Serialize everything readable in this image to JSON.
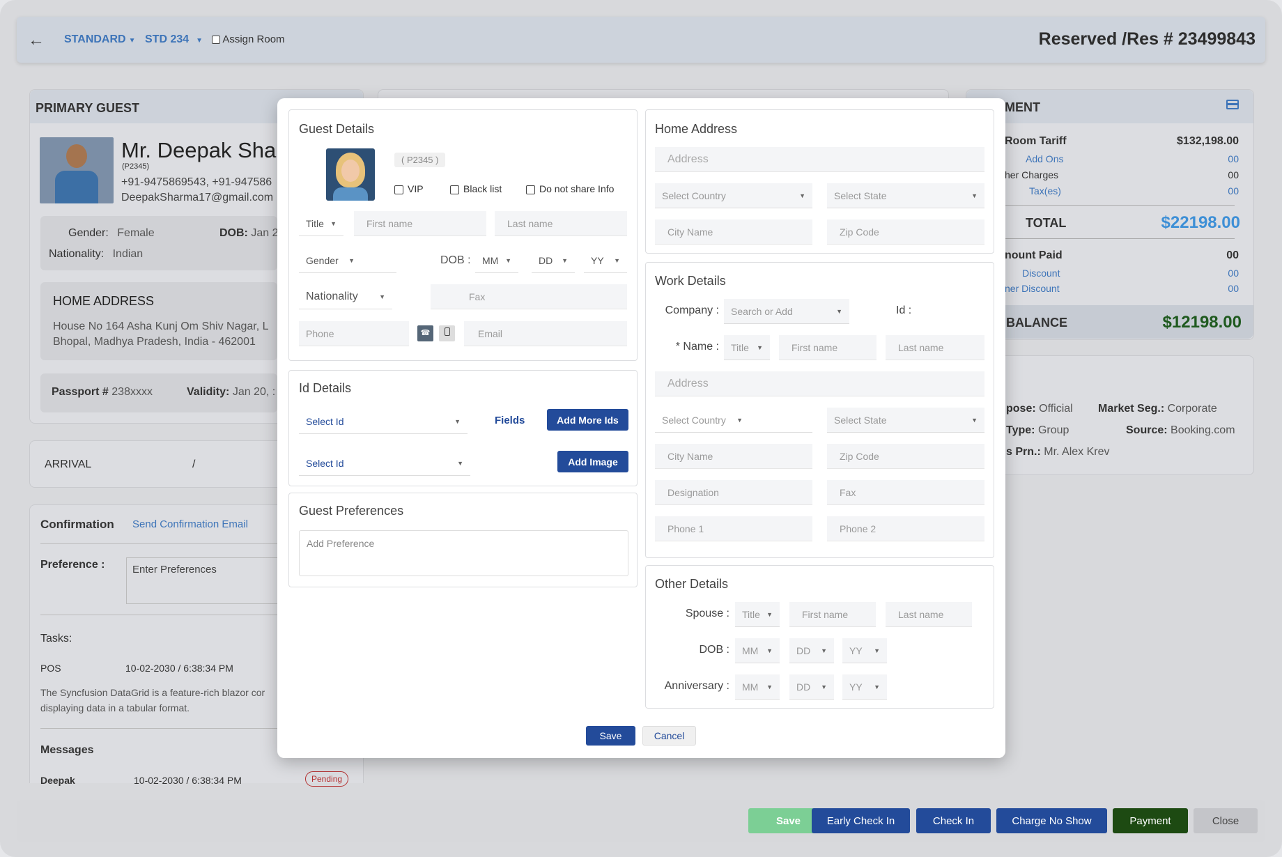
{
  "topbar": {
    "room_type": "STANDARD",
    "room_no": "STD 234",
    "assign_room": "Assign Room",
    "title": "Reserved /Res # 23499843"
  },
  "guest": {
    "section": "PRIMARY GUEST",
    "name": "Mr. Deepak Shar",
    "code": "(P2345)",
    "phones": "+91-9475869543, +91-947586",
    "email": "DeepakSharma17@gmail.com",
    "gender_label": "Gender:",
    "gender": "Female",
    "dob_label": "DOB:",
    "dob": "Jan 2",
    "nationality_label": "Nationality:",
    "nationality": "Indian",
    "home_address_title": "HOME ADDRESS",
    "address_line1": "House No 164 Asha Kunj Om Shiv Nagar, L",
    "address_line2": "Bhopal, Madhya Pradesh, India - 462001",
    "passport_label": "Passport #",
    "passport": "238xxxx",
    "validity_label": "Validity:",
    "validity": "Jan 20, :"
  },
  "arrival": {
    "label": "ARRIVAL",
    "sep": "/"
  },
  "confirmation": {
    "title": "Confirmation",
    "send_link": "Send Confirmation Email",
    "pref_label": "Preference :",
    "pref_placeholder": "Enter Preferences",
    "tasks_label": "Tasks:",
    "task_name": "POS",
    "task_time": "10-02-2030 / 6:38:34 PM",
    "task_desc1": "The Syncfusion DataGrid is a feature-rich blazor cor",
    "task_desc2": "displaying data in a tabular format.",
    "messages_label": "Messages",
    "msg_name": "Deepak",
    "msg_time": "10-02-2030 / 6:38:34 PM",
    "msg_status": "Pending"
  },
  "payment": {
    "title": "MENT",
    "room_tariff_label": "Room Tariff",
    "room_tariff": "$132,198.00",
    "addons_label": "Add Ons",
    "addons": "00",
    "other_charges_label": "her Charges",
    "other_charges": "00",
    "taxes_label": "Tax(es)",
    "taxes": "00",
    "total_label": "TOTAL",
    "total": "$22198.00",
    "amount_paid_label": "nount Paid",
    "amount_paid": "00",
    "discount_label": "Discount",
    "discount": "00",
    "other_discount_label": "ner Discount",
    "other_discount": "00",
    "balance_label": "BALANCE",
    "balance": "$12198.00"
  },
  "info": {
    "purpose_label": "pose:",
    "purpose": "Official",
    "market_label": "Market Seg.:",
    "market": "Corporate",
    "type_label": "Type:",
    "type": "Group",
    "source_label": "Source:",
    "source": "Booking.com",
    "prn_label": "s Prn.:",
    "prn": "Mr. Alex Krev"
  },
  "modal": {
    "guest_details": {
      "title": "Guest Details",
      "code": "( P2345 )",
      "vip": "VIP",
      "blacklist": "Black list",
      "no_share": "Do not share Info",
      "title_sel": "Title",
      "first_name": "First name",
      "last_name": "Last name",
      "gender_sel": "Gender",
      "dob_label": "DOB :",
      "mm": "MM",
      "dd": "DD",
      "yy": "YY",
      "nationality_sel": "Nationality",
      "fax": "Fax",
      "phone": "Phone",
      "email": "Email"
    },
    "id_details": {
      "title": "Id Details",
      "select_id1": "Select Id",
      "fields": "Fields",
      "add_more": "Add More Ids",
      "select_id2": "Select Id",
      "add_image": "Add Image"
    },
    "preferences": {
      "title": "Guest Preferences",
      "placeholder": "Add Preference"
    },
    "home_address": {
      "title": "Home Address",
      "address": "Address",
      "country": "Select Country",
      "state": "Select State",
      "city": "City Name",
      "zip": "Zip Code"
    },
    "work_details": {
      "title": "Work Details",
      "company_label": "Company :",
      "company_sel": "Search or Add",
      "id_label": "Id :",
      "name_label": "* Name :",
      "title_sel": "Title",
      "first_name": "First name",
      "last_name": "Last name",
      "address": "Address",
      "country": "Select Country",
      "state": "Select State",
      "city": "City Name",
      "zip": "Zip Code",
      "designation": "Designation",
      "fax": "Fax",
      "phone1": "Phone 1",
      "phone2": "Phone 2"
    },
    "other_details": {
      "title": "Other Details",
      "spouse_label": "Spouse :",
      "title_sel": "Title",
      "first_name": "First name",
      "last_name": "Last name",
      "dob_label": "DOB :",
      "anniv_label": "Anniversary :",
      "mm": "MM",
      "dd": "DD",
      "yy": "YY"
    },
    "save": "Save",
    "cancel": "Cancel"
  },
  "bottom": {
    "save": "Save",
    "early_check_in": "Early Check In",
    "check_in": "Check In",
    "charge_no_show": "Charge No Show",
    "payment": "Payment",
    "close": "Close"
  },
  "colors": {
    "accent": "#3d74b8",
    "primary_btn": "#234b9a",
    "total": "#3d8fd6",
    "balance": "#1f5a1f",
    "payment_btn": "#1d4a12",
    "save_btn": "#7ccf95"
  }
}
